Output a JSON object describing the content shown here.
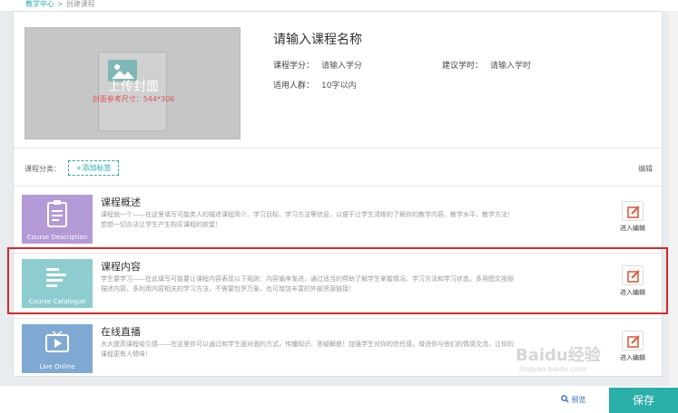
{
  "breadcrumb": {
    "parent": "教学中心",
    "sep": ">",
    "current": "创建课程"
  },
  "cover": {
    "upload_title": "上传封面",
    "size_hint": "封面参考尺寸：544*306"
  },
  "course": {
    "name_placeholder": "请输入课程名称",
    "credit_label": "课程学分：",
    "credit_placeholder": "请输入学分",
    "hours_label": "建议学时：",
    "hours_placeholder": "请输入学时",
    "audience_label": "适用人群：",
    "audience_placeholder": "10字以内"
  },
  "category": {
    "label": "课程分类：",
    "add_tag": "+添加标签",
    "edit": "编辑"
  },
  "sections": [
    {
      "title": "课程概述",
      "thumb_label": "Course Description",
      "color": "#b39ad6",
      "desc": "课程就一个——在这里填写可能类人的描述课程简介、学习目标、学习方法等信息，以便于让学生清晰的了解你的教学内容、教学水平、教学方法！想想一切办法让学生产生购买课程的欲望！",
      "edit": "进入编辑"
    },
    {
      "title": "课程内容",
      "thumb_label": "Course Catalogue",
      "color": "#8dcdcf",
      "desc": "学生要学习——在此填写可能要让课程内容表现以下规则：内容循序渐进，通过适当的帮助了解学生掌握情况、学习方法和学习状态，多用图文视频描述内容，多利用内容相关的学习方法，不需要包罗万象，也可增加丰富的外部资源链接！",
      "edit": "进入编辑"
    },
    {
      "title": "在线直播",
      "thumb_label": "Live Online",
      "color": "#7fa9d2",
      "desc": "大大提高课程吸引感——在这里你可以通过和学生面对面的方式，传播知识、答疑解惑！加强学生对你的信任感，增进你与他们的情感交流，让你的课程更有人情味！",
      "edit": "进入编辑"
    }
  ],
  "footer": {
    "preview": "预览",
    "save": "保存"
  },
  "watermark": {
    "main": "Baidu经验",
    "sub": "jingyan.baidu.com"
  },
  "colors": {
    "accent": "#2aaea8",
    "highlight": "#d42a2a"
  }
}
